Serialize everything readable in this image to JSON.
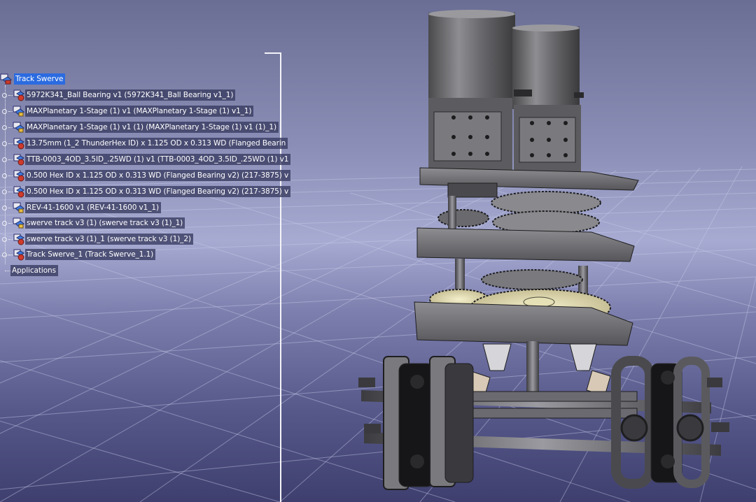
{
  "app": {
    "background": {
      "top": "#6a6e94",
      "mid": "#a7abd2",
      "bottom": "#3e3f6e"
    },
    "selection_color": "#2b6be0"
  },
  "tree": {
    "root": {
      "label": "Track Swerve",
      "icon": "product-icon",
      "selected": true
    },
    "items": [
      {
        "label": "5972K341_Ball Bearing v1 (5972K341_Ball Bearing v1_1)",
        "icon": "part-icon"
      },
      {
        "label": "MAXPlanetary 1-Stage (1) v1 (MAXPlanetary 1-Stage (1) v1_1)",
        "icon": "product-icon"
      },
      {
        "label": "MAXPlanetary 1-Stage (1) v1 (1) (MAXPlanetary 1-Stage (1) v1 (1)_1)",
        "icon": "product-icon"
      },
      {
        "label": "13.75mm (1_2 ThunderHex ID) x 1.125 OD x 0.313 WD (Flanged Bearin",
        "icon": "part-icon"
      },
      {
        "label": "TTB-0003_4OD_3.5ID_.25WD (1) v1 (TTB-0003_4OD_3.5ID_.25WD (1) v1",
        "icon": "part-icon"
      },
      {
        "label": "0.500 Hex ID x 1.125 OD x 0.313 WD (Flanged Bearing v2) (217-3875) v",
        "icon": "part-icon"
      },
      {
        "label": "0.500 Hex ID x 1.125 OD x 0.313 WD (Flanged Bearing v2) (217-3875) v",
        "icon": "part-icon"
      },
      {
        "label": "REV-41-1600 v1 (REV-41-1600 v1_1)",
        "icon": "product-icon"
      },
      {
        "label": "swerve track v3 (1) (swerve track v3 (1)_1)",
        "icon": "product-icon"
      },
      {
        "label": "swerve track v3 (1)_1 (swerve track v3 (1)_2)",
        "icon": "part-icon"
      },
      {
        "label": "Track Swerve_1 (Track Swerve_1.1)",
        "icon": "part-icon"
      }
    ],
    "applications": {
      "label": "Applications"
    }
  }
}
